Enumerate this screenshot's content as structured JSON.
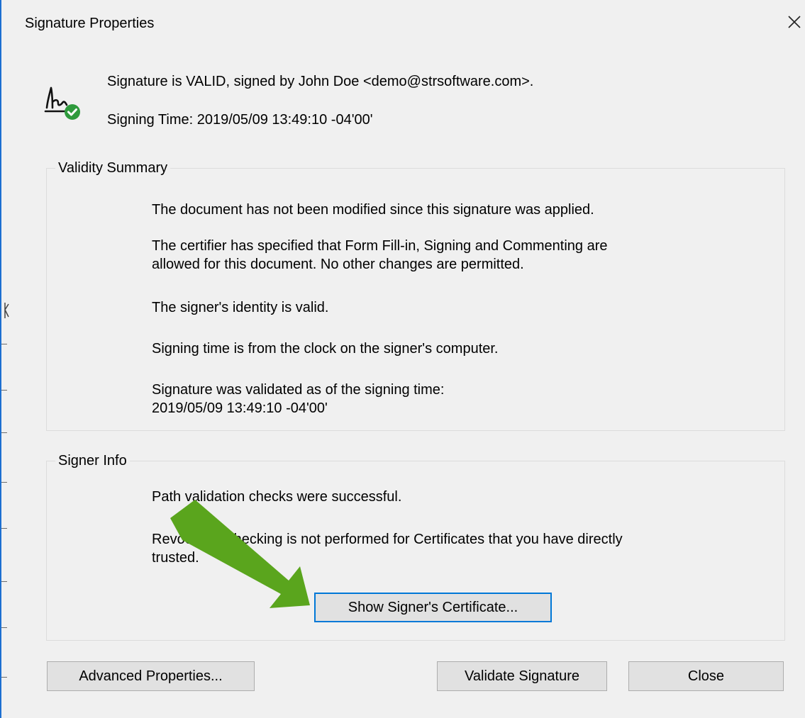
{
  "window": {
    "title": "Signature Properties",
    "close_icon": "close-icon"
  },
  "summary": {
    "icon": "signature-valid-icon",
    "status": "Signature is VALID, signed by John Doe <demo@strsoftware.com>.",
    "signing_time": "Signing Time:  2019/05/09 13:49:10 -04'00'"
  },
  "validity": {
    "legend": "Validity Summary",
    "lines": [
      "The document has not been modified since this signature was applied.",
      "The certifier has specified that Form Fill-in, Signing and Commenting are",
      "allowed for this document. No other changes are permitted.",
      "The signer's identity is valid.",
      "Signing time is from the clock on the signer's computer.",
      "Signature was validated as of the signing time:",
      "2019/05/09 13:49:10 -04'00'"
    ]
  },
  "signer": {
    "legend": "Signer Info",
    "lines": [
      "Path validation checks were successful.",
      "Revocation checking is not performed for Certificates that you have directly",
      "trusted."
    ],
    "show_cert_label": "Show Signer's Certificate..."
  },
  "buttons": {
    "advanced": "Advanced Properties...",
    "validate": "Validate Signature",
    "close": "Close"
  },
  "colors": {
    "accent": "#0078d7",
    "valid_green": "#2e9a3c",
    "arrow_green": "#5aa51d"
  }
}
